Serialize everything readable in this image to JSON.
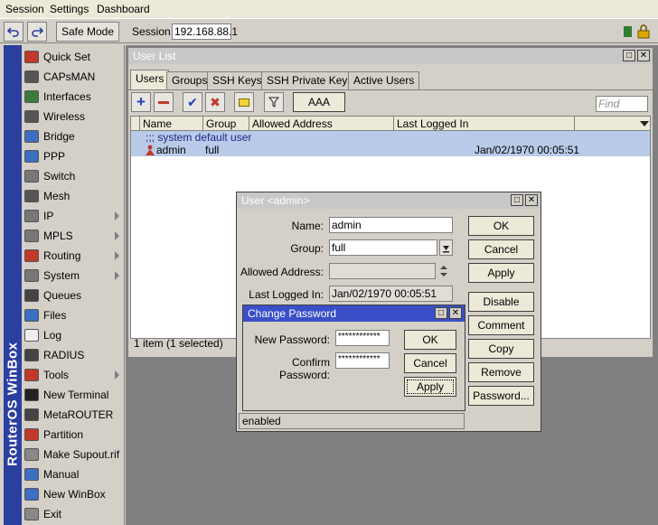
{
  "menu": {
    "items": [
      "Session",
      "Settings",
      "Dashboard"
    ]
  },
  "toolbar": {
    "safe_mode": "Safe Mode",
    "session_label": "Session:",
    "session_value": "192.168.88.1"
  },
  "brand": "RouterOS WinBox",
  "sidebar": {
    "items": [
      {
        "label": "Quick Set",
        "color": "#c0392b"
      },
      {
        "label": "CAPsMAN",
        "color": "#555"
      },
      {
        "label": "Interfaces",
        "color": "#3a7a3a"
      },
      {
        "label": "Wireless",
        "color": "#555"
      },
      {
        "label": "Bridge",
        "color": "#3c6ec2"
      },
      {
        "label": "PPP",
        "color": "#3c6ec2"
      },
      {
        "label": "Switch",
        "color": "#777"
      },
      {
        "label": "Mesh",
        "color": "#555"
      },
      {
        "label": "IP",
        "color": "#777"
      },
      {
        "label": "MPLS",
        "color": "#777"
      },
      {
        "label": "Routing",
        "color": "#c0392b"
      },
      {
        "label": "System",
        "color": "#777"
      },
      {
        "label": "Queues",
        "color": "#444"
      },
      {
        "label": "Files",
        "color": "#3c6ec2"
      },
      {
        "label": "Log",
        "color": "#eee"
      },
      {
        "label": "RADIUS",
        "color": "#444"
      },
      {
        "label": "Tools",
        "color": "#c0392b"
      },
      {
        "label": "New Terminal",
        "color": "#222"
      },
      {
        "label": "MetaROUTER",
        "color": "#444"
      },
      {
        "label": "Partition",
        "color": "#c0392b"
      },
      {
        "label": "Make Supout.rif",
        "color": "#888"
      },
      {
        "label": "Manual",
        "color": "#3c6ec2"
      },
      {
        "label": "New WinBox",
        "color": "#3c6ec2"
      },
      {
        "label": "Exit",
        "color": "#888"
      }
    ]
  },
  "user_list": {
    "title": "User List",
    "tabs": [
      "Users",
      "Groups",
      "SSH Keys",
      "SSH Private Keys",
      "Active Users"
    ],
    "aaa": "AAA",
    "find_placeholder": "Find",
    "columns": [
      "Name",
      "Group",
      "Allowed Address",
      "Last Logged In"
    ],
    "comment_row": ";;; system default user",
    "rows": [
      {
        "name": "admin",
        "group": "full",
        "allowed": "",
        "last": "Jan/02/1970 00:05:51"
      }
    ],
    "status": "1 item (1 selected)"
  },
  "user_dialog": {
    "title": "User <admin>",
    "name_label": "Name:",
    "name_value": "admin",
    "group_label": "Group:",
    "group_value": "full",
    "allowed_label": "Allowed Address:",
    "allowed_value": "",
    "last_label": "Last Logged In:",
    "last_value": "Jan/02/1970 00:05:51",
    "buttons": [
      "OK",
      "Cancel",
      "Apply",
      "Disable",
      "Comment",
      "Copy",
      "Remove",
      "Password..."
    ],
    "status": "enabled"
  },
  "password_dialog": {
    "title": "Change Password",
    "new_label": "New Password:",
    "new_value": "************",
    "confirm_label": "Confirm Password:",
    "confirm_value": "************",
    "ok": "OK",
    "cancel": "Cancel",
    "apply": "Apply"
  }
}
